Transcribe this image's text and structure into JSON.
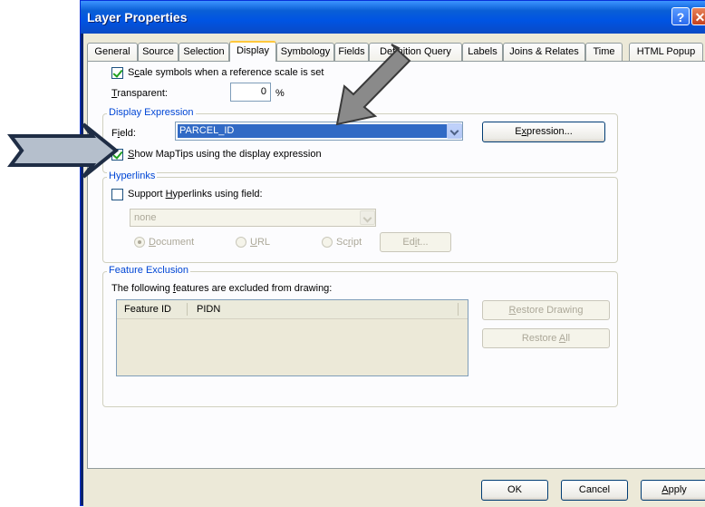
{
  "window": {
    "title": "Layer Properties",
    "help_glyph": "?",
    "close_glyph": "✕"
  },
  "tabs": [
    {
      "label": "General"
    },
    {
      "label": "Source"
    },
    {
      "label": "Selection"
    },
    {
      "label": "Display",
      "active": true
    },
    {
      "label": "Symbology"
    },
    {
      "label": "Fields"
    },
    {
      "label": "Definition Query"
    },
    {
      "label": "Labels"
    },
    {
      "label": "Joins & Relates"
    },
    {
      "label": "Time"
    },
    {
      "label": "HTML Popup"
    }
  ],
  "display": {
    "scale_symbols": {
      "pre": "S",
      "acc": "c",
      "post": "ale symbols when a reference scale is set",
      "checked": true
    },
    "transparent": {
      "acc": "T",
      "post": "ransparent:",
      "value": "0",
      "unit": "%"
    }
  },
  "display_expression": {
    "title": "Display Expression",
    "field_label": {
      "pre": "F",
      "acc": "i",
      "post": "eld:"
    },
    "field_value": "PARCEL_ID",
    "expression_button": {
      "pre": "E",
      "acc": "x",
      "post": "pression..."
    },
    "maptips": {
      "acc": "S",
      "post": "how MapTips using the display expression",
      "checked": true
    }
  },
  "hyperlinks": {
    "title": "Hyperlinks",
    "support": {
      "pre": "Support ",
      "acc": "H",
      "post": "yperlinks using field:",
      "checked": false
    },
    "field_value": "none",
    "options": [
      {
        "acc": "D",
        "post": "ocument",
        "checked": true
      },
      {
        "acc": "U",
        "post": "RL",
        "checked": false
      },
      {
        "pre": "Sc",
        "acc": "r",
        "post": "ipt",
        "checked": false
      }
    ],
    "edit_button": {
      "pre": "Ed",
      "acc": "i",
      "post": "t..."
    }
  },
  "feature_exclusion": {
    "title": "Feature Exclusion",
    "description": {
      "pre": "The following ",
      "acc": "f",
      "post": "eatures are excluded from drawing:"
    },
    "columns": [
      "Feature ID",
      "PIDN"
    ],
    "restore_drawing": {
      "acc": "R",
      "post": "estore Drawing"
    },
    "restore_all": {
      "pre": "Restore ",
      "acc": "A",
      "post": "ll"
    }
  },
  "footer": {
    "ok": "OK",
    "cancel": "Cancel",
    "apply": {
      "acc": "A",
      "post": "pply"
    }
  },
  "colors": {
    "titlebar": "#0054e3",
    "dialog_bg": "#ece9d8",
    "selection_bg": "#316ac5",
    "group_title": "#0046d5",
    "annotation_arrow": "#8a8a8a"
  }
}
